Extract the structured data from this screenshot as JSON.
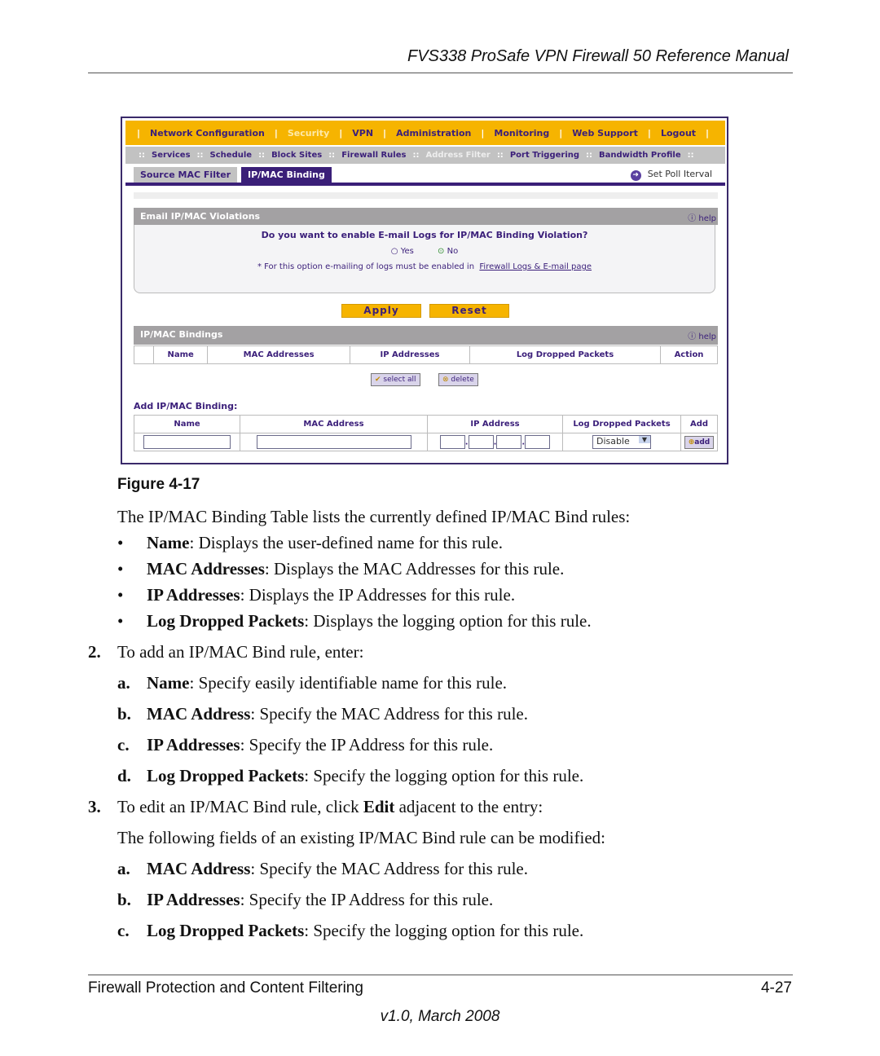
{
  "header": {
    "title": "FVS338 ProSafe VPN Firewall 50 Reference Manual"
  },
  "screenshot": {
    "nav": [
      "Network Configuration",
      "Security",
      "VPN",
      "Administration",
      "Monitoring",
      "Web Support",
      "Logout"
    ],
    "subnav": [
      "Services",
      "Schedule",
      "Block Sites",
      "Firewall Rules",
      "Address Filter",
      "Port Triggering",
      "Bandwidth Profile"
    ],
    "tabs": [
      "Source MAC Filter",
      "IP/MAC Binding"
    ],
    "poll": "Set Poll Iterval",
    "email_section": {
      "title": "Email IP/MAC Violations",
      "help": "help",
      "question": "Do you want to enable E-mail Logs for IP/MAC Binding Violation?",
      "yes": "Yes",
      "no": "No",
      "selected": "No",
      "note": "* For this option e-mailing of logs must be enabled in",
      "link": "Firewall Logs & E-mail page"
    },
    "apply": "Apply",
    "reset": "Reset",
    "bindings": {
      "title": "IP/MAC Bindings",
      "help": "help",
      "columns": [
        "Name",
        "MAC Addresses",
        "IP Addresses",
        "Log Dropped Packets",
        "Action"
      ],
      "select_all": "select all",
      "delete": "delete"
    },
    "add": {
      "title": "Add IP/MAC Binding:",
      "columns": [
        "Name",
        "MAC Address",
        "IP Address",
        "Log Dropped Packets",
        "Add"
      ],
      "log_value": "Disable",
      "add_button": "add"
    },
    "colors": {
      "nav": "#f6b400",
      "accent": "#3b1f7a",
      "section": "#a3a1a3"
    }
  },
  "figure": "Figure 4-17",
  "body": {
    "intro": "The IP/MAC Binding Table lists the currently defined IP/MAC Bind rules:",
    "bullets": [
      [
        "Name",
        ": Displays the user-defined name for this rule."
      ],
      [
        "MAC Addresses",
        ": Displays the MAC Addresses for this rule."
      ],
      [
        "IP Addresses",
        ": Displays the IP Addresses for this rule."
      ],
      [
        "Log Dropped Packets",
        ": Displays the logging option for this rule."
      ]
    ],
    "step2": {
      "num": "2.",
      "text": "To add an IP/MAC Bind rule, enter:"
    },
    "step2_items": [
      [
        "a.",
        "Name",
        ": Specify easily identifiable name for this rule."
      ],
      [
        "b.",
        "MAC Address",
        ": Specify the MAC Address for this rule."
      ],
      [
        "c.",
        "IP Addresses",
        ": Specify the IP Address for this rule."
      ],
      [
        "d.",
        "Log Dropped Packets",
        ": Specify the logging option for this rule."
      ]
    ],
    "step3": {
      "num": "3.",
      "pre": "To edit an IP/MAC Bind rule, click ",
      "bold": "Edit",
      "post": " adjacent to the entry:"
    },
    "step3_intro": "The following fields of an existing IP/MAC Bind rule can be modified:",
    "step3_items": [
      [
        "a.",
        "MAC Address",
        ": Specify the MAC Address for this rule."
      ],
      [
        "b.",
        "IP Addresses",
        ": Specify the IP Address for this rule."
      ],
      [
        "c.",
        "Log Dropped Packets",
        ": Specify the logging option for this rule."
      ]
    ]
  },
  "footer": {
    "left": "Firewall Protection and Content Filtering",
    "right": "4-27",
    "version": "v1.0, March 2008"
  }
}
